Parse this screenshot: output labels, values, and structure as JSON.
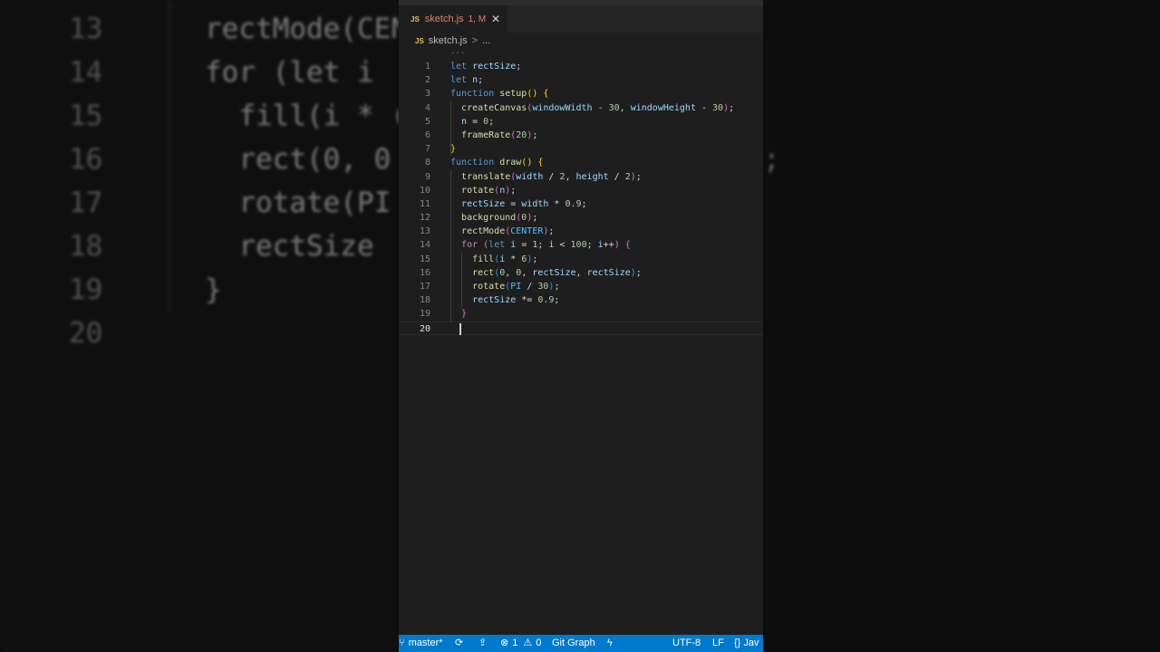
{
  "tab": {
    "icon": "JS",
    "filename": "sketch.js",
    "status": "1, M",
    "close": "✕"
  },
  "breadcrumb": {
    "icon": "JS",
    "file": "sketch.js",
    "separator": ">",
    "more": "..."
  },
  "code_lines": [
    {
      "num": "1",
      "tokens": [
        [
          "kw",
          "let"
        ],
        [
          "pl",
          " "
        ],
        [
          "vr",
          "rectSize"
        ],
        [
          "pl",
          ";"
        ]
      ]
    },
    {
      "num": "2",
      "tokens": [
        [
          "kw",
          "let"
        ],
        [
          "pl",
          " "
        ],
        [
          "vr",
          "n"
        ],
        [
          "pl",
          ";"
        ]
      ]
    },
    {
      "num": "3",
      "tokens": [
        [
          "kw",
          "function"
        ],
        [
          "pl",
          " "
        ],
        [
          "fn",
          "setup"
        ],
        [
          "b1",
          "()"
        ],
        [
          "pl",
          " "
        ],
        [
          "b1",
          "{"
        ]
      ]
    },
    {
      "num": "4",
      "tokens": [
        [
          "pl",
          "  "
        ],
        [
          "fn",
          "createCanvas"
        ],
        [
          "b2",
          "("
        ],
        [
          "vr",
          "windowWidth"
        ],
        [
          "pl",
          " - "
        ],
        [
          "nm",
          "30"
        ],
        [
          "pl",
          ", "
        ],
        [
          "vr",
          "windowHeight"
        ],
        [
          "pl",
          " - "
        ],
        [
          "nm",
          "30"
        ],
        [
          "b2",
          ")"
        ],
        [
          "pl",
          ";"
        ]
      ]
    },
    {
      "num": "5",
      "tokens": [
        [
          "pl",
          "  "
        ],
        [
          "vr",
          "n"
        ],
        [
          "pl",
          " = "
        ],
        [
          "nm",
          "0"
        ],
        [
          "pl",
          ";"
        ]
      ]
    },
    {
      "num": "6",
      "tokens": [
        [
          "pl",
          "  "
        ],
        [
          "fn",
          "frameRate"
        ],
        [
          "b2",
          "("
        ],
        [
          "nm",
          "20"
        ],
        [
          "b2",
          ")"
        ],
        [
          "pl",
          ";"
        ]
      ]
    },
    {
      "num": "7",
      "tokens": [
        [
          "b1",
          "}"
        ]
      ]
    },
    {
      "num": "8",
      "tokens": [
        [
          "kw",
          "function"
        ],
        [
          "pl",
          " "
        ],
        [
          "fn",
          "draw"
        ],
        [
          "b1",
          "()"
        ],
        [
          "pl",
          " "
        ],
        [
          "b1",
          "{"
        ]
      ]
    },
    {
      "num": "9",
      "tokens": [
        [
          "pl",
          "  "
        ],
        [
          "fn",
          "translate"
        ],
        [
          "b2",
          "("
        ],
        [
          "vr",
          "width"
        ],
        [
          "pl",
          " / "
        ],
        [
          "nm",
          "2"
        ],
        [
          "pl",
          ", "
        ],
        [
          "vr",
          "height"
        ],
        [
          "pl",
          " / "
        ],
        [
          "nm",
          "2"
        ],
        [
          "b2",
          ")"
        ],
        [
          "pl",
          ";"
        ]
      ]
    },
    {
      "num": "10",
      "tokens": [
        [
          "pl",
          "  "
        ],
        [
          "fn",
          "rotate"
        ],
        [
          "b2",
          "("
        ],
        [
          "vr",
          "n"
        ],
        [
          "b2",
          ")"
        ],
        [
          "pl",
          ";"
        ]
      ]
    },
    {
      "num": "11",
      "tokens": [
        [
          "pl",
          "  "
        ],
        [
          "vr",
          "rectSize"
        ],
        [
          "pl",
          " = "
        ],
        [
          "vr",
          "width"
        ],
        [
          "pl",
          " * "
        ],
        [
          "nm",
          "0.9"
        ],
        [
          "pl",
          ";"
        ]
      ]
    },
    {
      "num": "12",
      "tokens": [
        [
          "pl",
          "  "
        ],
        [
          "fn",
          "background"
        ],
        [
          "b2",
          "("
        ],
        [
          "nm",
          "0"
        ],
        [
          "b2",
          ")"
        ],
        [
          "pl",
          ";"
        ]
      ]
    },
    {
      "num": "13",
      "tokens": [
        [
          "pl",
          "  "
        ],
        [
          "fn",
          "rectMode"
        ],
        [
          "b2",
          "("
        ],
        [
          "cs",
          "CENTER"
        ],
        [
          "b2",
          ")"
        ],
        [
          "pl",
          ";"
        ]
      ]
    },
    {
      "num": "14",
      "tokens": [
        [
          "pl",
          "  "
        ],
        [
          "kwc",
          "for"
        ],
        [
          "pl",
          " "
        ],
        [
          "b2",
          "("
        ],
        [
          "kw",
          "let"
        ],
        [
          "pl",
          " "
        ],
        [
          "vr",
          "i"
        ],
        [
          "pl",
          " = "
        ],
        [
          "nm",
          "1"
        ],
        [
          "pl",
          "; "
        ],
        [
          "vr",
          "i"
        ],
        [
          "pl",
          " < "
        ],
        [
          "nm",
          "100"
        ],
        [
          "pl",
          "; "
        ],
        [
          "vr",
          "i"
        ],
        [
          "pl",
          "++"
        ],
        [
          "b2",
          ")"
        ],
        [
          "pl",
          " "
        ],
        [
          "b2",
          "{"
        ]
      ]
    },
    {
      "num": "15",
      "tokens": [
        [
          "pl",
          "    "
        ],
        [
          "fn",
          "fill"
        ],
        [
          "b3",
          "("
        ],
        [
          "vr",
          "i"
        ],
        [
          "pl",
          " * "
        ],
        [
          "nm",
          "6"
        ],
        [
          "b3",
          ")"
        ],
        [
          "pl",
          ";"
        ]
      ]
    },
    {
      "num": "16",
      "tokens": [
        [
          "pl",
          "    "
        ],
        [
          "fn",
          "rect"
        ],
        [
          "b3",
          "("
        ],
        [
          "nm",
          "0"
        ],
        [
          "pl",
          ", "
        ],
        [
          "nm",
          "0"
        ],
        [
          "pl",
          ", "
        ],
        [
          "vr",
          "rectSize"
        ],
        [
          "pl",
          ", "
        ],
        [
          "vr",
          "rectSize"
        ],
        [
          "b3",
          ")"
        ],
        [
          "pl",
          ";"
        ]
      ]
    },
    {
      "num": "17",
      "tokens": [
        [
          "pl",
          "    "
        ],
        [
          "fn",
          "rotate"
        ],
        [
          "b3",
          "("
        ],
        [
          "cs",
          "PI"
        ],
        [
          "pl",
          " / "
        ],
        [
          "nm",
          "30"
        ],
        [
          "b3",
          ")"
        ],
        [
          "pl",
          ";"
        ]
      ]
    },
    {
      "num": "18",
      "tokens": [
        [
          "pl",
          "    "
        ],
        [
          "vr",
          "rectSize"
        ],
        [
          "pl",
          " *= "
        ],
        [
          "nm",
          "0.9"
        ],
        [
          "pl",
          ";"
        ]
      ]
    },
    {
      "num": "19",
      "tokens": [
        [
          "pl",
          "  "
        ],
        [
          "b2",
          "}"
        ]
      ]
    },
    {
      "num": "20",
      "tokens": []
    }
  ],
  "fold_marker": "...",
  "background_zoom": [
    {
      "num": "13",
      "text": "rectMode(CEN"
    },
    {
      "num": "14",
      "text": "for (let i"
    },
    {
      "num": "15",
      "text": "  fill(i * ("
    },
    {
      "num": "16",
      "text": "  rect(0, 0"
    },
    {
      "num": "17",
      "text": "  rotate(PI"
    },
    {
      "num": "18",
      "text": "  rectSize"
    },
    {
      "num": "19",
      "text": "}"
    },
    {
      "num": "20",
      "text": ""
    }
  ],
  "background_right_fragment": ";",
  "status_bar": {
    "branch_icon": "git-branch-icon",
    "branch": "master*",
    "sync_icon": "sync-icon",
    "publish_icon": "publish-icon",
    "errors": "1",
    "warnings": "0",
    "git_graph": "Git Graph",
    "encoding": "UTF-8",
    "eol": "LF",
    "language": "{} Jav"
  }
}
